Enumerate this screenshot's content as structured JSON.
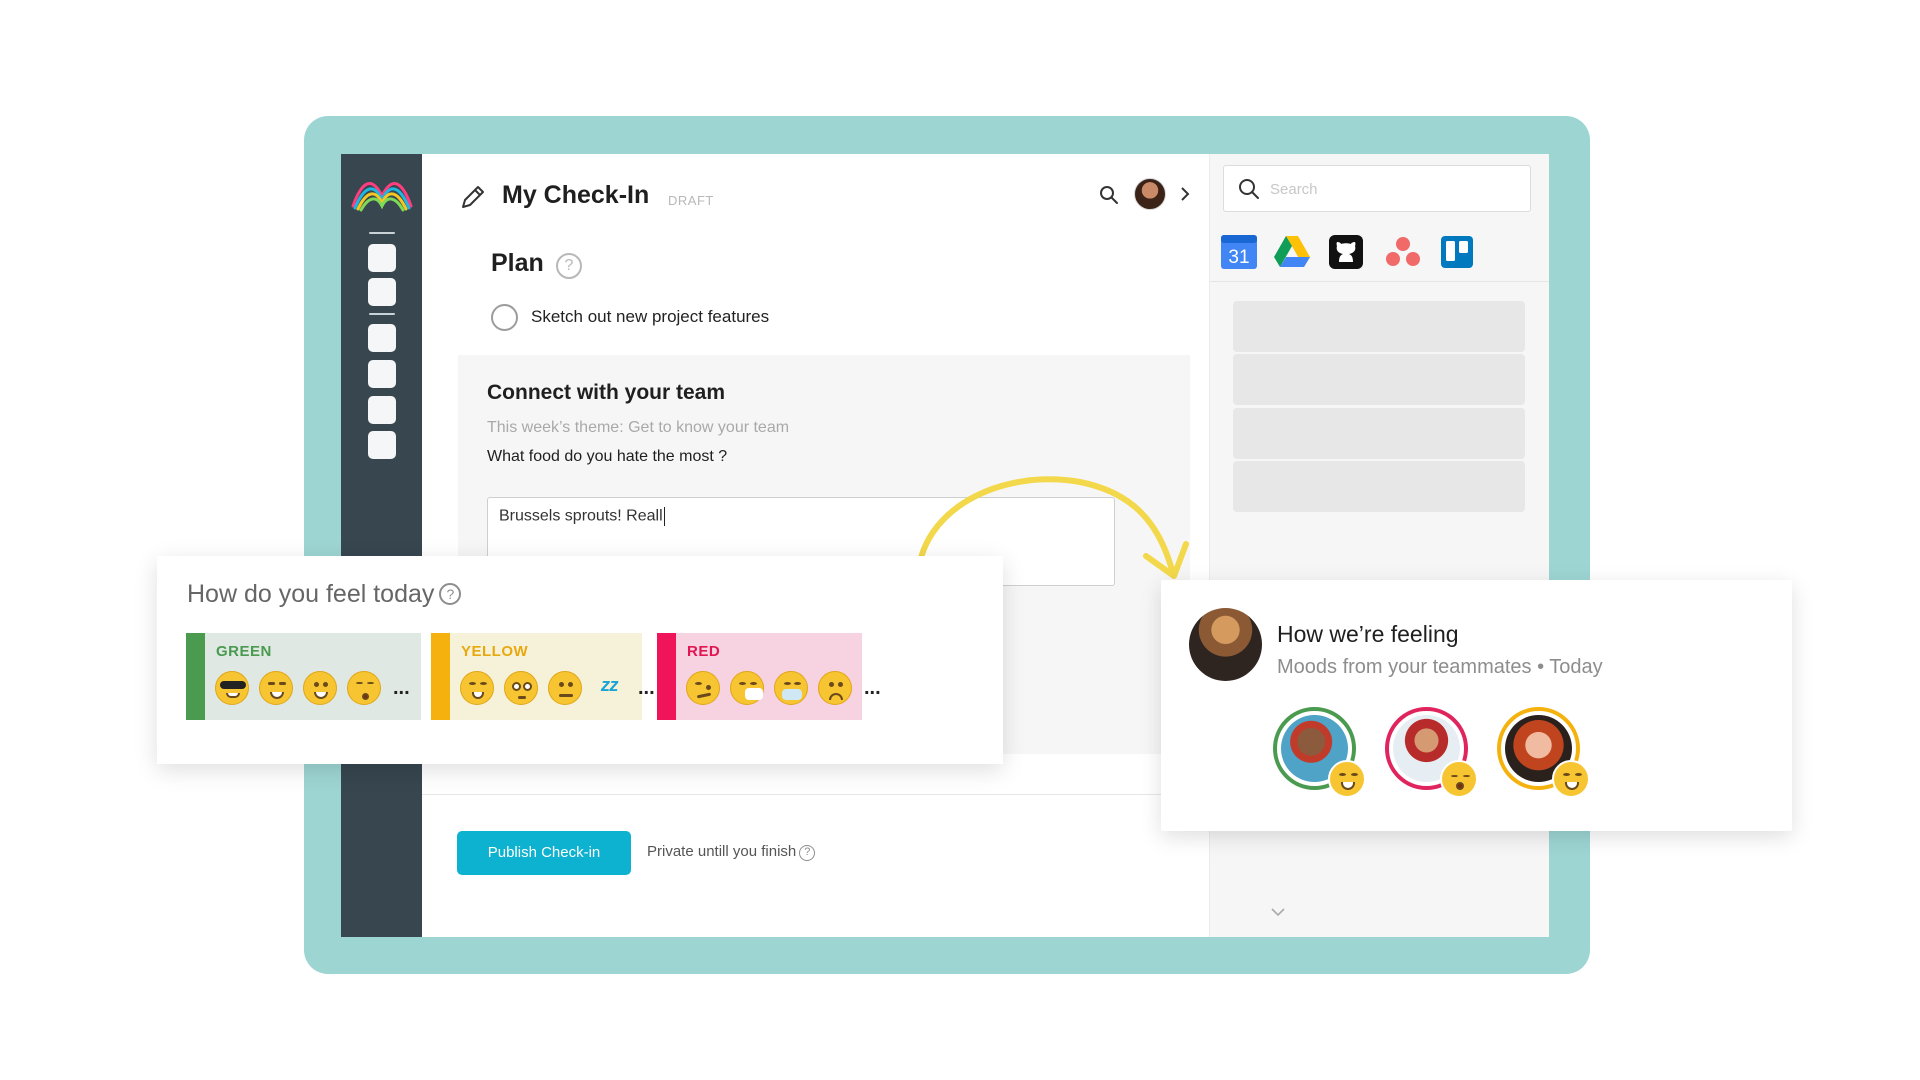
{
  "header": {
    "title": "My Check-In",
    "status": "DRAFT"
  },
  "plan": {
    "title": "Plan",
    "help": "?",
    "tasks": [
      {
        "label": "Sketch out new project features",
        "checked": false
      }
    ]
  },
  "connect": {
    "title": "Connect with your team",
    "theme": "This week’s theme: Get to know your team",
    "question": "What food do you hate the most ?",
    "answer": "Brussels sprouts! Reall"
  },
  "footer": {
    "publish_label": "Publish Check-in",
    "private_text": "Private untill you finish",
    "help": "?"
  },
  "sidebar": {
    "search_placeholder": "Search",
    "calendar_day": "31",
    "apps": [
      "google-calendar-icon",
      "google-drive-icon",
      "github-icon",
      "asana-icon",
      "trello-icon"
    ]
  },
  "feel": {
    "title": "How do you feel today",
    "help": "?",
    "moods": [
      {
        "label": "GREEN",
        "color": "#4a9a4f",
        "bg": "#dfe8e3",
        "text_color": "#4a9a4f",
        "more": "..."
      },
      {
        "label": "YELLOW",
        "color": "#f5b20e",
        "bg": "#f6f2d9",
        "text_color": "#e8a90f",
        "more": "..."
      },
      {
        "label": "RED",
        "color": "#f0145a",
        "bg": "#f7d3e1",
        "text_color": "#e01552",
        "more": "..."
      }
    ]
  },
  "team": {
    "title": "How we’re feeling",
    "subtitle": "Moods from your teammates • Today",
    "mates": [
      {
        "ring_color": "#4a9a4f"
      },
      {
        "ring_color": "#e0245e"
      },
      {
        "ring_color": "#f5b20e"
      }
    ]
  },
  "colors": {
    "frame": "#9dd5d3",
    "rail": "#37464f",
    "publish": "#0cb2cf",
    "arrow": "#f2d84a"
  }
}
